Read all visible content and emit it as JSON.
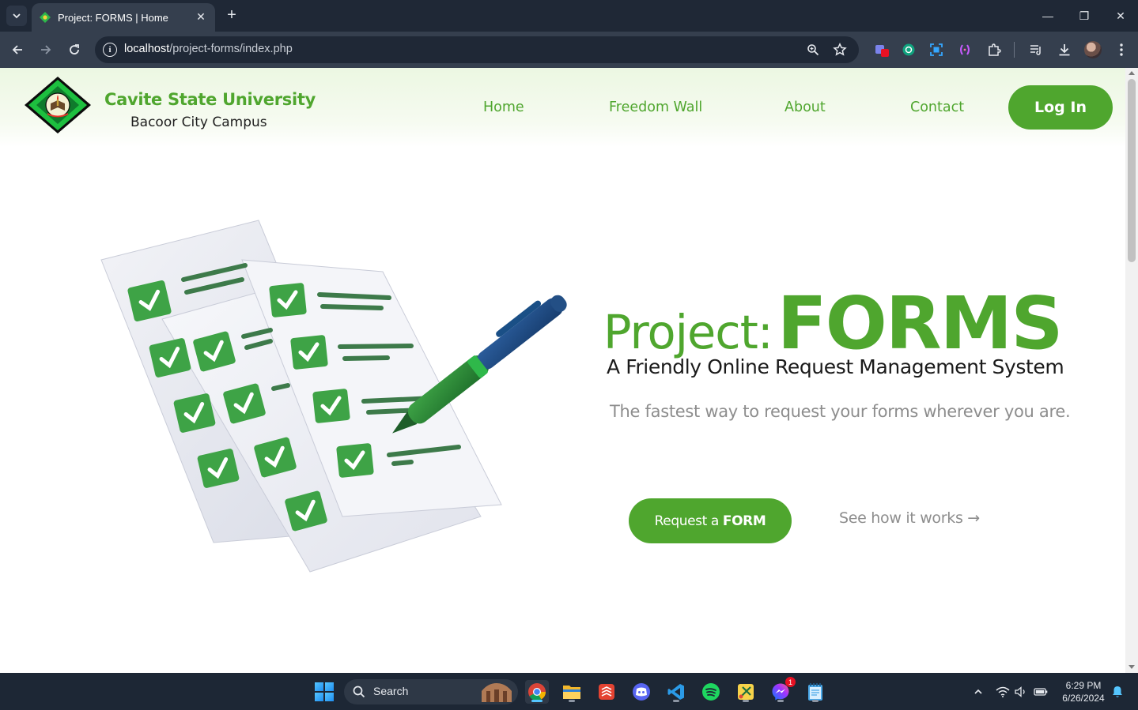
{
  "browser": {
    "tab_title": "Project: FORMS | Home",
    "url_host": "localhost",
    "url_path": "/project-forms/index.php",
    "tab_close_glyph": "✕",
    "new_tab_glyph": "+",
    "minimize_glyph": "—",
    "restore_glyph": "❐",
    "close_glyph": "✕"
  },
  "header": {
    "brand_name": "Cavite State University",
    "brand_subtitle": "Bacoor City Campus",
    "nav": [
      {
        "label": "Home"
      },
      {
        "label": "Freedom Wall"
      },
      {
        "label": "About"
      },
      {
        "label": "Contact"
      }
    ],
    "login_label": "Log In"
  },
  "hero": {
    "title_lead": "Project:",
    "title_main": "FORMS",
    "subtitle": "A Friendly Online Request Management System",
    "tagline": "The fastest way to request your forms wherever you are.",
    "cta_prefix": "Request a",
    "cta_emphasis": "FORM",
    "secondary_link": "See how it works →"
  },
  "taskbar": {
    "search_placeholder": "Search",
    "clock_time": "6:29 PM",
    "clock_date": "6/26/2024",
    "messenger_badge": "1"
  },
  "colors": {
    "brand_green": "#4fa62e",
    "browser_dark": "#1f2836",
    "browser_toolbar": "#353f4e",
    "taskbar": "#1d2735",
    "muted_text": "#8d8d8d"
  },
  "icons": {
    "tab_search": "chevron-down-icon",
    "back": "back-arrow-icon",
    "forward": "forward-arrow-icon",
    "reload": "reload-icon",
    "site_info": "info-icon",
    "zoom": "zoom-icon",
    "bookmark": "star-icon",
    "downloads": "download-icon",
    "menu": "kebab-menu-icon"
  }
}
